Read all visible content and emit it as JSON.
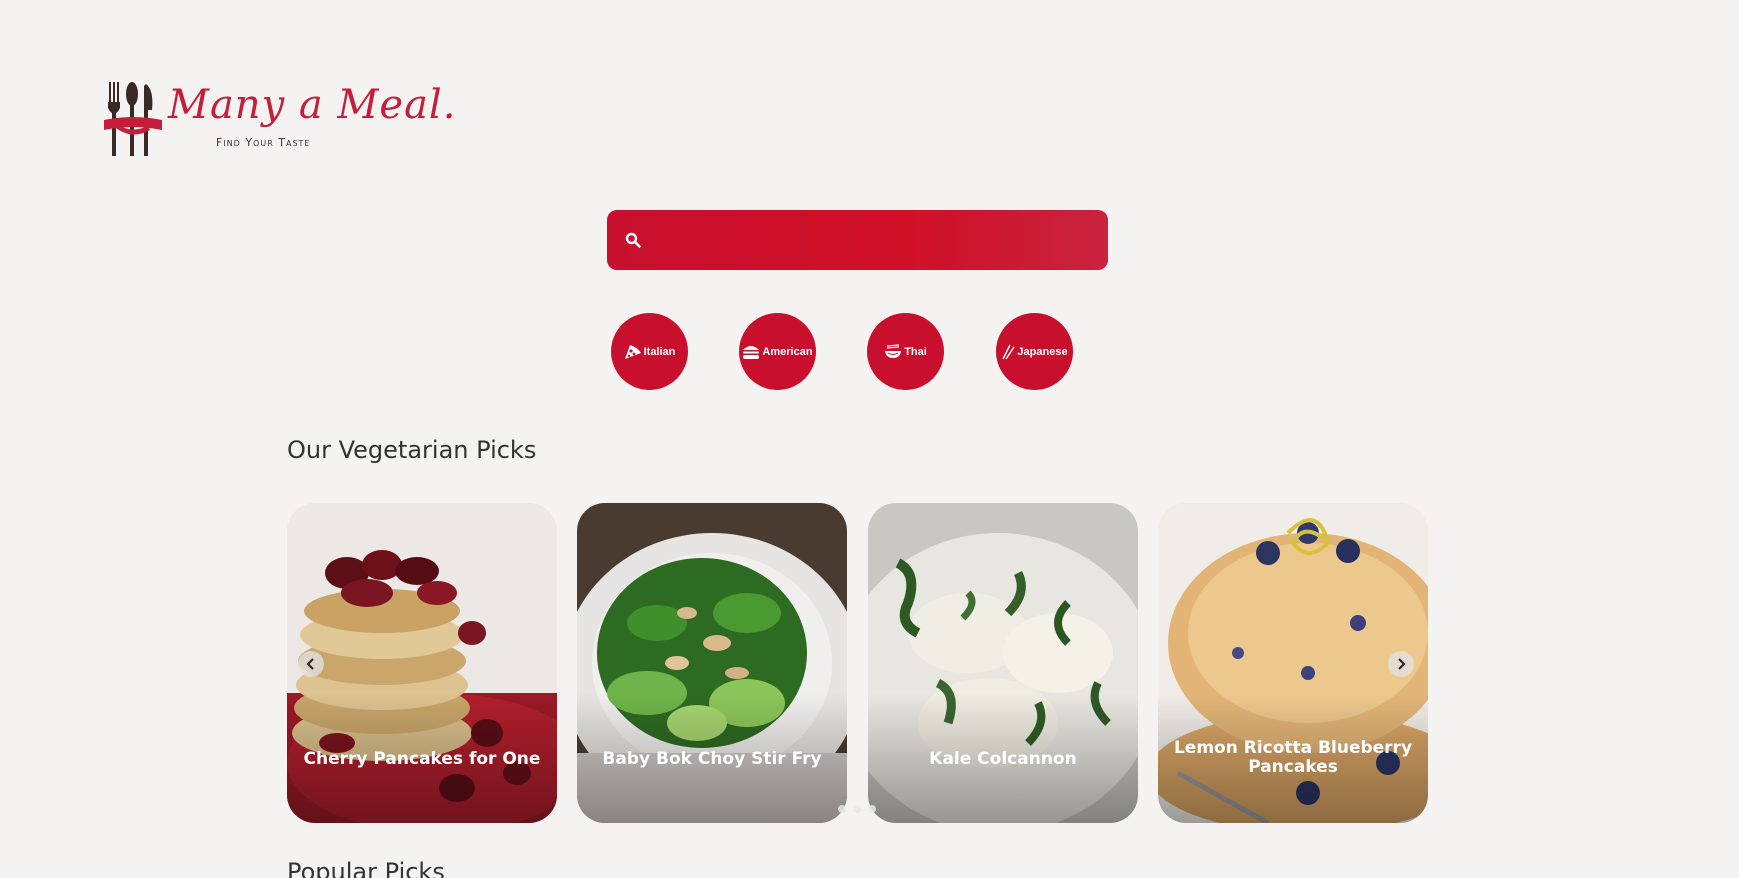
{
  "brand": {
    "name": "Many a Meal.",
    "tagline": "Find Your Taste",
    "colors": {
      "primary": "#c8102e",
      "background": "#f5f3f1",
      "text": "#333333"
    }
  },
  "search": {
    "icon": "search-icon",
    "value": "",
    "placeholder": ""
  },
  "cuisines": [
    {
      "label": "Italian",
      "icon": "pizza-icon"
    },
    {
      "label": "American",
      "icon": "burger-icon"
    },
    {
      "label": "Thai",
      "icon": "noodle-bowl-icon"
    },
    {
      "label": "Japanese",
      "icon": "chopsticks-icon"
    }
  ],
  "vegetarian": {
    "title": "Our Vegetarian Picks",
    "cards": [
      {
        "title": "Cherry Pancakes for One"
      },
      {
        "title": "Baby Bok Choy Stir Fry"
      },
      {
        "title": "Kale Colcannon"
      },
      {
        "title": "Lemon Ricotta Blueberry Pancakes"
      }
    ],
    "pagination": {
      "pages": 3,
      "current": 1
    }
  },
  "popular": {
    "title": "Popular Picks"
  }
}
